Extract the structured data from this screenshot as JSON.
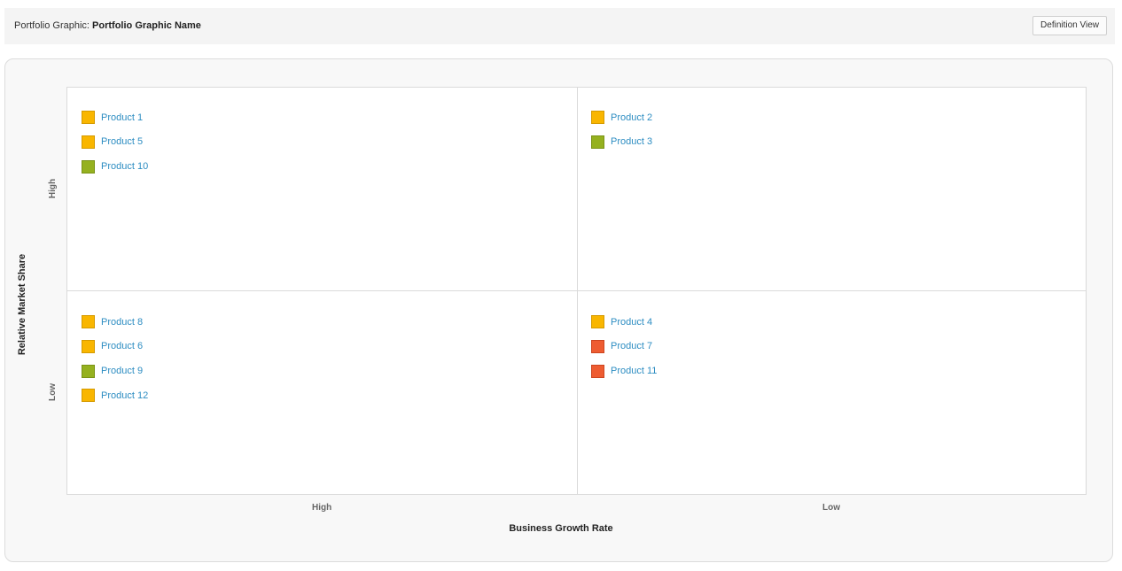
{
  "header": {
    "prefix": "Portfolio Graphic:",
    "name": "Portfolio Graphic Name",
    "definition_view_label": "Definition View"
  },
  "axes": {
    "x_title": "Business Growth Rate",
    "x_high": "High",
    "x_low": "Low",
    "y_title": "Relative Market Share",
    "y_high": "High",
    "y_low": "Low"
  },
  "colors": {
    "orange": "#f9b600",
    "green": "#95b11f",
    "red": "#ee5c31",
    "link": "#2d8dc2"
  },
  "quadrants": {
    "top_left": [
      {
        "label": "Product 1",
        "status": "orange"
      },
      {
        "label": "Product 5",
        "status": "orange"
      },
      {
        "label": "Product 10",
        "status": "green"
      }
    ],
    "top_right": [
      {
        "label": "Product 2",
        "status": "orange"
      },
      {
        "label": "Product 3",
        "status": "green"
      }
    ],
    "bottom_left": [
      {
        "label": "Product 8",
        "status": "orange"
      },
      {
        "label": "Product 6",
        "status": "orange"
      },
      {
        "label": "Product 9",
        "status": "green"
      },
      {
        "label": "Product 12",
        "status": "orange"
      }
    ],
    "bottom_right": [
      {
        "label": "Product 4",
        "status": "orange"
      },
      {
        "label": "Product 7",
        "status": "red"
      },
      {
        "label": "Product 11",
        "status": "red"
      }
    ]
  }
}
